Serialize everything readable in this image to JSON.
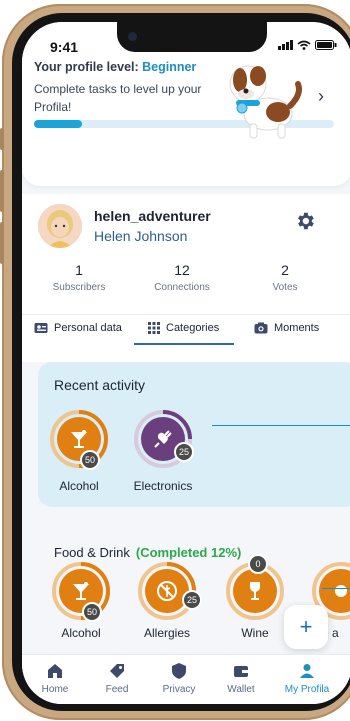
{
  "status_bar": {
    "time": "9:41"
  },
  "level_card": {
    "prefix": "Your profile level: ",
    "level": "Beginner",
    "description": "Complete tasks to level up your Profila!",
    "progress": 0.16
  },
  "profile": {
    "username": "helen_adventurer",
    "full_name": "Helen Johnson",
    "stats": [
      {
        "value": "1",
        "label": "Subscribers"
      },
      {
        "value": "12",
        "label": "Connections"
      },
      {
        "value": "2",
        "label": "Votes"
      }
    ]
  },
  "tabs": [
    {
      "label": "Personal data",
      "icon": "id-card-icon"
    },
    {
      "label": "Categories",
      "icon": "grid-icon"
    },
    {
      "label": "Moments",
      "icon": "camera-icon"
    }
  ],
  "recent_activity": {
    "title": "Recent activity",
    "items": [
      {
        "label": "Alcohol",
        "badge": "50",
        "icon": "cocktail-icon",
        "color": "#e07f12"
      },
      {
        "label": "Electronics",
        "badge": "25",
        "icon": "plug-icon",
        "color": "#6b3f7e"
      }
    ]
  },
  "food_drink": {
    "title": "Food & Drink",
    "completed": "(Completed 12%)",
    "items": [
      {
        "label": "Alcohol",
        "badge": "50",
        "icon": "cocktail-icon"
      },
      {
        "label": "Allergies",
        "badge": "25",
        "icon": "no-wheat-icon"
      },
      {
        "label": "Wine",
        "badge": "0",
        "icon": "wine-glass-icon"
      },
      {
        "label": "e a",
        "badge": "",
        "icon": "food-icon"
      }
    ]
  },
  "fab": {
    "label": "+"
  },
  "nav": [
    {
      "label": "Home",
      "icon": "home-icon"
    },
    {
      "label": "Feed",
      "icon": "tag-icon"
    },
    {
      "label": "Privacy",
      "icon": "shield-icon"
    },
    {
      "label": "Wallet",
      "icon": "wallet-icon"
    },
    {
      "label": "My Profila",
      "icon": "person-icon"
    }
  ],
  "colors": {
    "accent": "#1b8fc0",
    "orange": "#e07f12",
    "purple": "#6b3f7e",
    "green": "#2da84a"
  }
}
